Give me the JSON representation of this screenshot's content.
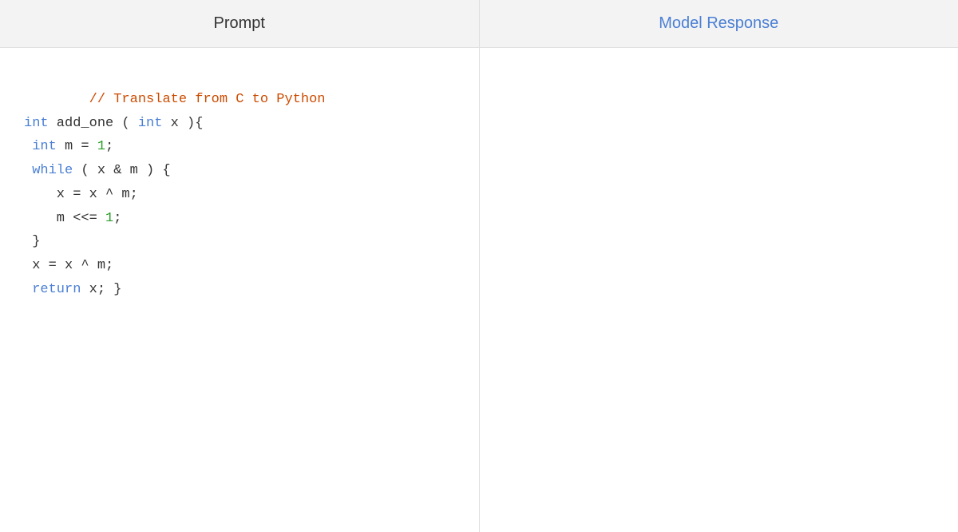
{
  "header": {
    "prompt_label": "Prompt",
    "response_label": "Model Response"
  },
  "prompt": {
    "lines": [
      {
        "tokens": [
          {
            "text": "// Translate from C to Python",
            "color": "comment"
          }
        ]
      },
      {
        "tokens": [
          {
            "text": "int",
            "color": "keyword"
          },
          {
            "text": " add_one ( ",
            "color": "default"
          },
          {
            "text": "int",
            "color": "keyword"
          },
          {
            "text": " x ){",
            "color": "default"
          }
        ]
      },
      {
        "tokens": [
          {
            "text": " ",
            "color": "default"
          },
          {
            "text": "int",
            "color": "keyword"
          },
          {
            "text": " m = ",
            "color": "default"
          },
          {
            "text": "1",
            "color": "number"
          },
          {
            "text": ";",
            "color": "default"
          }
        ]
      },
      {
        "tokens": [
          {
            "text": " ",
            "color": "default"
          },
          {
            "text": "while",
            "color": "keyword"
          },
          {
            "text": " ( x & m ) {",
            "color": "default"
          }
        ]
      },
      {
        "tokens": [
          {
            "text": "    x = x ^ m;",
            "color": "default"
          }
        ]
      },
      {
        "tokens": [
          {
            "text": "    m <<= ",
            "color": "default"
          },
          {
            "text": "1",
            "color": "number"
          },
          {
            "text": ";",
            "color": "default"
          }
        ]
      },
      {
        "tokens": [
          {
            "text": " }",
            "color": "default"
          }
        ]
      },
      {
        "tokens": [
          {
            "text": " x = x ^ m;",
            "color": "default"
          }
        ]
      },
      {
        "tokens": [
          {
            "text": " ",
            "color": "default"
          },
          {
            "text": "return",
            "color": "keyword"
          },
          {
            "text": " x; }",
            "color": "default"
          }
        ]
      }
    ]
  }
}
